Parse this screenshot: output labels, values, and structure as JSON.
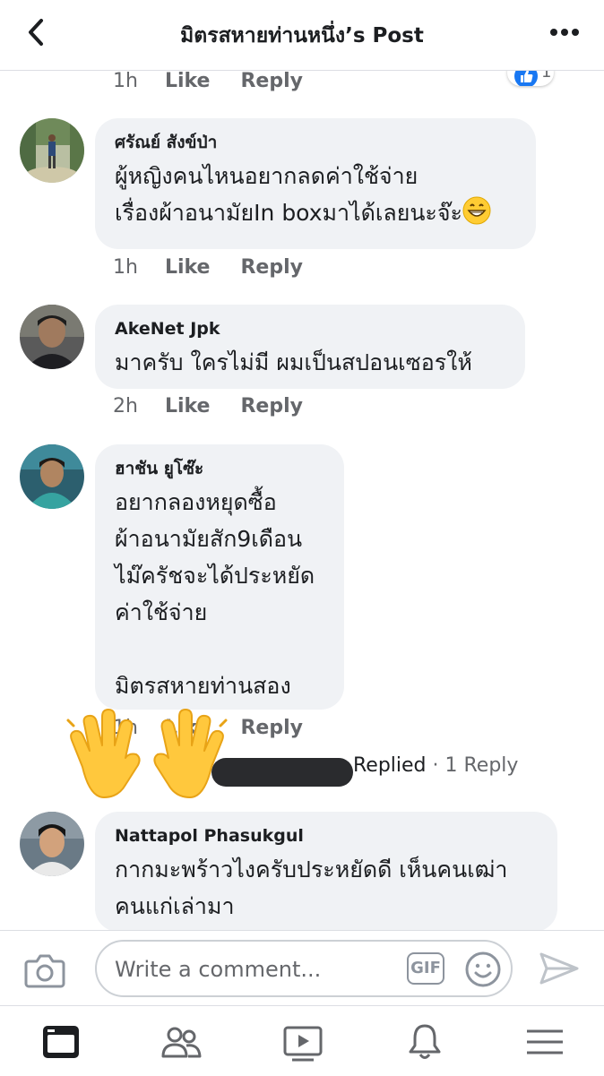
{
  "header": {
    "title": "มิตรสหายท่านหนึ่ง’s Post"
  },
  "top_actions": {
    "time": "1h",
    "like": "Like",
    "reply": "Reply",
    "reaction_count": "1"
  },
  "comments": [
    {
      "author": "ศรัณย์ สังข์ป่า",
      "text": "ผู้หญิงคนไหนอยากลดค่าใช้จ่าย\nเรื่องผ้าอนามัยIn boxมาได้เลยนะจ๊ะ",
      "emoji": "grinning-face-emoji",
      "time": "1h",
      "like": "Like",
      "reply": "Reply"
    },
    {
      "author": "AkeNet Jpk",
      "text": "มาครับ ใครไม่มี ผมเป็นสปอนเซอรให้",
      "time": "2h",
      "like": "Like",
      "reply": "Reply"
    },
    {
      "author": "ฮาชัน ยูโซ๊ะ",
      "text": "อยากลองหยุดซื้อ\nผ้าอนามัยสัก9เดือน\nไม๊ครัชจะได้ประหยัด\nค่าใช้จ่าย\n\nมิตรสหายท่านสอง",
      "time": "1h",
      "like": "Like",
      "reply": "Reply",
      "replied_label": "Replied",
      "reply_count": "· 1 Reply"
    },
    {
      "author": "Nattapol Phasukgul",
      "text": "กากมะพร้าวไงครับประหยัดดี เห็นคนเฒ่า\nคนแก่เล่ามา"
    }
  ],
  "composer": {
    "placeholder": "Write a comment...",
    "gif_label": "GIF"
  },
  "tabs": [
    "news-feed-icon",
    "friends-icon",
    "watch-icon",
    "notifications-icon",
    "menu-icon"
  ],
  "colors": {
    "bubble": "#f0f2f5",
    "meta": "#65676b",
    "like_blue": "#1877f2"
  }
}
